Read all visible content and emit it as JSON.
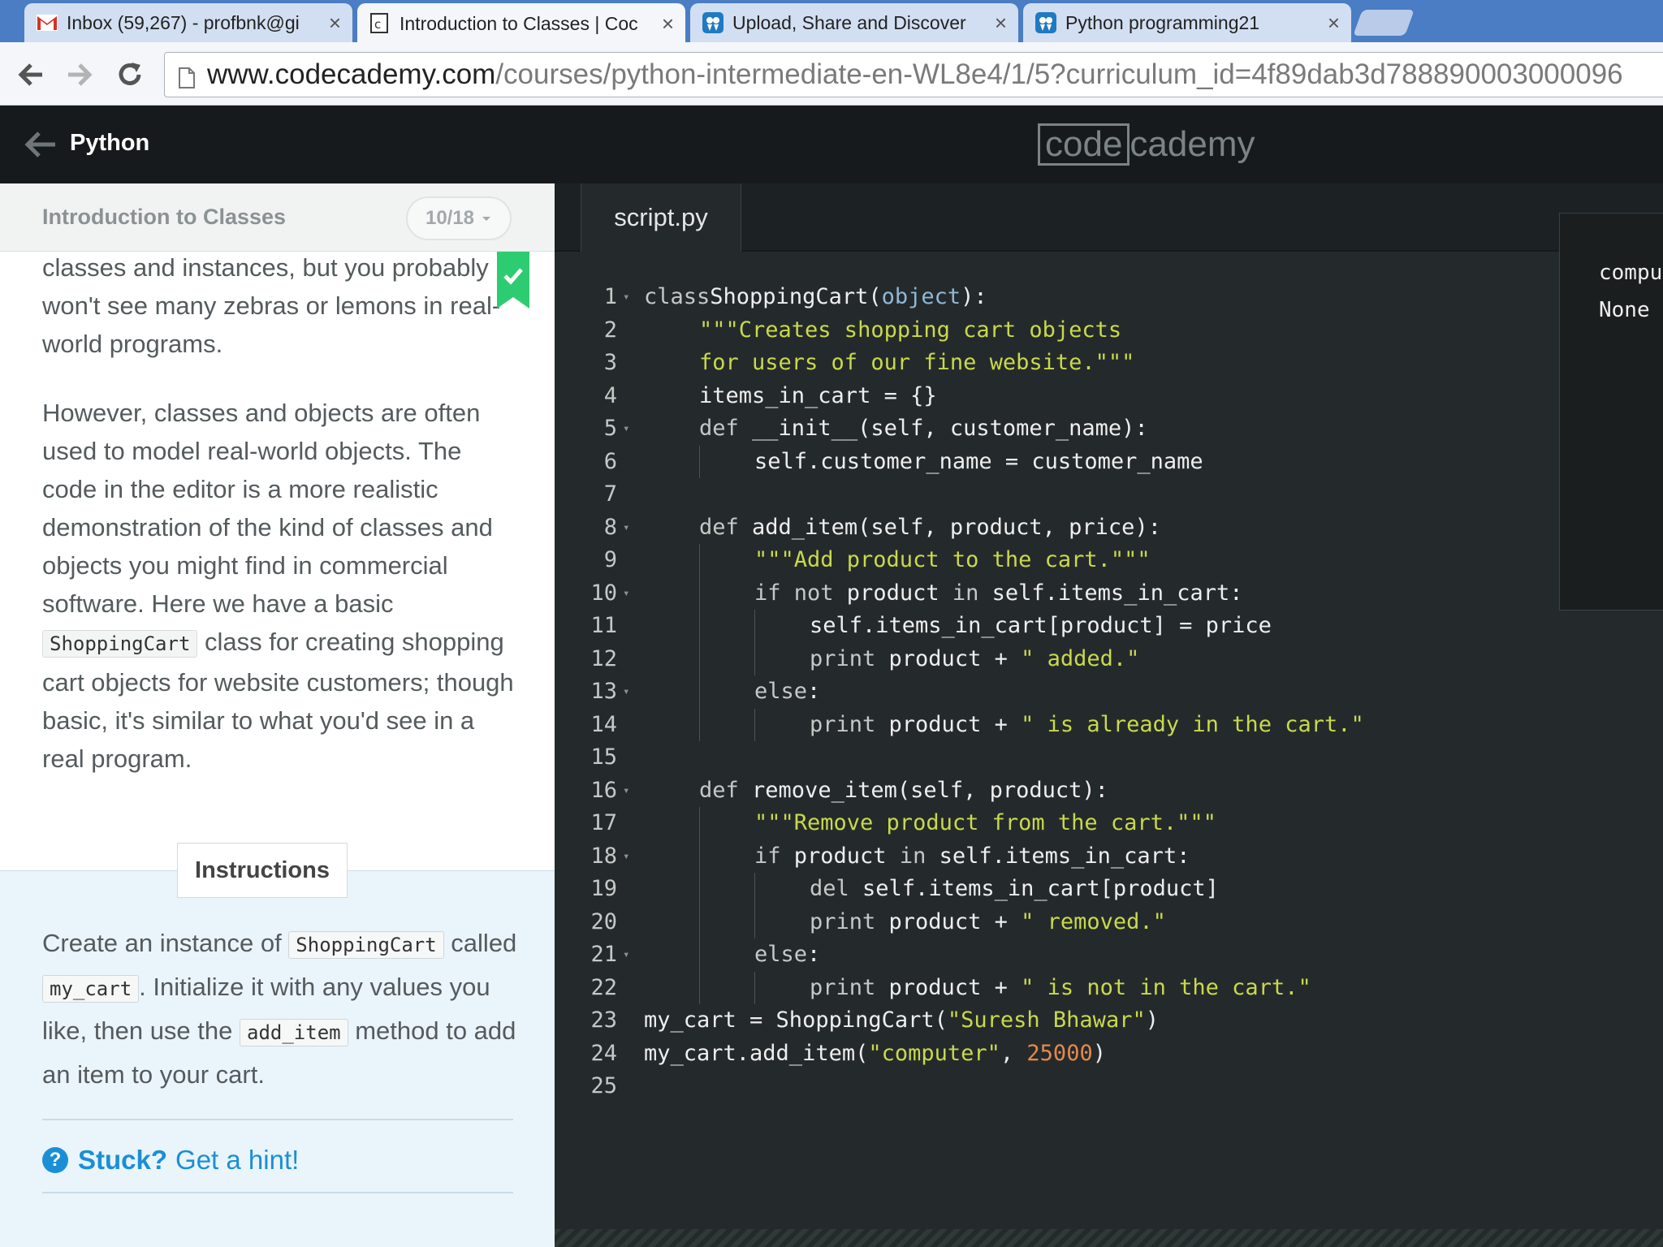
{
  "browser": {
    "tabs": [
      {
        "title": "Inbox (59,267) - profbnk@gi",
        "icon": "gmail-icon"
      },
      {
        "title": "Introduction to Classes | Coc",
        "icon": "codecademy-icon"
      },
      {
        "title": "Upload, Share and Discover",
        "icon": "slideshare-icon"
      },
      {
        "title": "Python programming21",
        "icon": "slideshare-icon"
      }
    ],
    "close_glyph": "×",
    "url_host": "www.codecademy.com",
    "url_path": "/courses/python-intermediate-en-WL8e4/1/5?curriculum_id=4f89dab3d788890003000096"
  },
  "app": {
    "course": "Python",
    "logo_boxed": "code",
    "logo_rest": "cademy"
  },
  "lesson": {
    "title": "Introduction to Classes",
    "progress": "10/18",
    "para1": "classes and instances, but you probably won't see many zebras or lemons in real-world programs.",
    "para2_a": "However, classes and objects are often used to model real-world objects. The code in the editor is a more realistic demonstration of the kind of classes and objects you might find in commercial software. Here we have a basic ",
    "para2_code": "ShoppingCart",
    "para2_b": " class for creating shopping cart objects for website customers; though basic, it's similar to what you'd see in a real program.",
    "instructions_label": "Instructions",
    "instr_a": "Create an instance of ",
    "instr_code1": "ShoppingCart",
    "instr_b": " called ",
    "instr_code2": "my_cart",
    "instr_c": ". Initialize it with any values you like, then use the ",
    "instr_code3": "add_item",
    "instr_d": " method to add an item to your cart.",
    "stuck": "Stuck?",
    "hint": "Get a hint!"
  },
  "editor": {
    "filename": "script.py",
    "lines": [
      {
        "n": "1",
        "fold": true,
        "indent": 0,
        "tokens": [
          [
            "kw",
            "class"
          ],
          [
            "",
            "ShoppingCart("
          ],
          [
            "bi",
            "object"
          ],
          [
            "",
            "):"
          ]
        ]
      },
      {
        "n": "2",
        "fold": false,
        "indent": 1,
        "tokens": [
          [
            "str",
            "\"\"\"Creates shopping cart objects"
          ]
        ]
      },
      {
        "n": "3",
        "fold": false,
        "indent": 1,
        "tokens": [
          [
            "str",
            "for users of our fine website.\"\"\""
          ]
        ]
      },
      {
        "n": "4",
        "fold": false,
        "indent": 1,
        "tokens": [
          [
            "",
            "items_in_cart = {}"
          ]
        ]
      },
      {
        "n": "5",
        "fold": true,
        "indent": 1,
        "tokens": [
          [
            "kw",
            "def"
          ],
          [
            "",
            " __init__(self, customer_name):"
          ]
        ]
      },
      {
        "n": "6",
        "fold": false,
        "indent": 2,
        "tokens": [
          [
            "",
            "self.customer_name = customer_name"
          ]
        ]
      },
      {
        "n": "7",
        "fold": false,
        "indent": 0,
        "tokens": []
      },
      {
        "n": "8",
        "fold": true,
        "indent": 1,
        "tokens": [
          [
            "kw",
            "def"
          ],
          [
            "",
            " add_item(self, product, price):"
          ]
        ]
      },
      {
        "n": "9",
        "fold": false,
        "indent": 2,
        "tokens": [
          [
            "str",
            "\"\"\"Add product to the cart.\"\"\""
          ]
        ]
      },
      {
        "n": "10",
        "fold": true,
        "indent": 2,
        "tokens": [
          [
            "kw",
            "if not"
          ],
          [
            "",
            " product "
          ],
          [
            "kw",
            "in"
          ],
          [
            "",
            " self.items_in_cart:"
          ]
        ]
      },
      {
        "n": "11",
        "fold": false,
        "indent": 3,
        "tokens": [
          [
            "",
            "self.items_in_cart[product] = price"
          ]
        ]
      },
      {
        "n": "12",
        "fold": false,
        "indent": 3,
        "tokens": [
          [
            "kw",
            "print"
          ],
          [
            "",
            " product + "
          ],
          [
            "str",
            "\" added.\""
          ]
        ]
      },
      {
        "n": "13",
        "fold": true,
        "indent": 2,
        "tokens": [
          [
            "kw",
            "else"
          ],
          [
            "",
            ":"
          ]
        ]
      },
      {
        "n": "14",
        "fold": false,
        "indent": 3,
        "tokens": [
          [
            "kw",
            "print"
          ],
          [
            "",
            " product + "
          ],
          [
            "str",
            "\" is already in the cart.\""
          ]
        ]
      },
      {
        "n": "15",
        "fold": false,
        "indent": 0,
        "tokens": []
      },
      {
        "n": "16",
        "fold": true,
        "indent": 1,
        "tokens": [
          [
            "kw",
            "def"
          ],
          [
            "",
            " remove_item(self, product):"
          ]
        ]
      },
      {
        "n": "17",
        "fold": false,
        "indent": 2,
        "tokens": [
          [
            "str",
            "\"\"\"Remove product from the cart.\"\"\""
          ]
        ]
      },
      {
        "n": "18",
        "fold": true,
        "indent": 2,
        "tokens": [
          [
            "kw",
            "if"
          ],
          [
            "",
            " product "
          ],
          [
            "kw",
            "in"
          ],
          [
            "",
            " self.items_in_cart:"
          ]
        ]
      },
      {
        "n": "19",
        "fold": false,
        "indent": 3,
        "tokens": [
          [
            "kw",
            "del"
          ],
          [
            "",
            " self.items_in_cart[product]"
          ]
        ]
      },
      {
        "n": "20",
        "fold": false,
        "indent": 3,
        "tokens": [
          [
            "kw",
            "print"
          ],
          [
            "",
            " product + "
          ],
          [
            "str",
            "\" removed.\""
          ]
        ]
      },
      {
        "n": "21",
        "fold": true,
        "indent": 2,
        "tokens": [
          [
            "kw",
            "else"
          ],
          [
            "",
            ":"
          ]
        ]
      },
      {
        "n": "22",
        "fold": false,
        "indent": 3,
        "tokens": [
          [
            "kw",
            "print"
          ],
          [
            "",
            " product + "
          ],
          [
            "str",
            "\" is not in the cart.\""
          ]
        ]
      },
      {
        "n": "23",
        "fold": false,
        "indent": 0,
        "tokens": [
          [
            "",
            "my_cart = ShoppingCart("
          ],
          [
            "str",
            "\"Suresh Bhawar\""
          ],
          [
            "",
            ")"
          ]
        ]
      },
      {
        "n": "24",
        "fold": false,
        "indent": 0,
        "tokens": [
          [
            "",
            "my_cart.add_item("
          ],
          [
            "str",
            "\"computer\""
          ],
          [
            "",
            ", "
          ],
          [
            "num",
            "25000"
          ],
          [
            "",
            ")"
          ]
        ]
      },
      {
        "n": "25",
        "fold": false,
        "indent": 0,
        "tokens": []
      }
    ]
  },
  "output": {
    "lines": [
      "computer added.",
      "None"
    ]
  },
  "colors": {
    "accent_blue": "#1a8fd6",
    "bookmark_green": "#2ecc71",
    "string_green": "#c9d94a",
    "number_orange": "#e5894a"
  }
}
